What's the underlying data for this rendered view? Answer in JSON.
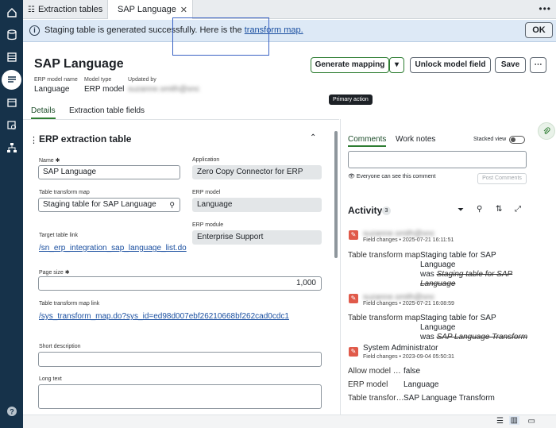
{
  "tabs": {
    "tab1": "Extraction tables",
    "tab2": "SAP Language"
  },
  "banner": {
    "message": "Staging table is generated successfully. Here is the ",
    "link": "transform map.",
    "ok": "OK"
  },
  "record": {
    "title": "SAP Language",
    "meta_model_name_label": "ERP model name",
    "meta_model_name": "Language",
    "meta_model_type_label": "Model type",
    "meta_model_type": "ERP model",
    "meta_updated_label": "Updated by",
    "meta_updated": "suzanne.smith@snc"
  },
  "buttons": {
    "generate": "Generate mapping",
    "unlock": "Unlock model field",
    "save": "Save",
    "tooltip": "Primary action"
  },
  "form_tabs": {
    "details": "Details",
    "fields": "Extraction table fields"
  },
  "section": {
    "title": "ERP extraction table"
  },
  "form": {
    "name_label": "Name",
    "name_value": "SAP Language",
    "application_label": "Application",
    "application_value": "Zero Copy Connector for ERP",
    "ttm_label": "Table transform map",
    "ttm_value": "Staging table for SAP Language",
    "erp_model_label": "ERP model",
    "erp_model_value": "Language",
    "erp_module_label": "ERP module",
    "erp_module_value": "Enterprise Support",
    "target_link_label": "Target table link",
    "target_link_value": "/sn_erp_integration_sap_language_list.do",
    "page_size_label": "Page size",
    "page_size_value": "1,000",
    "ttm_link_label": "Table transform map link",
    "ttm_link_value": "/sys_transform_map.do?sys_id=ed98d007ebf26210668bf262cad0cdc1",
    "short_desc_label": "Short description",
    "long_text_label": "Long text"
  },
  "right": {
    "comments_tab": "Comments",
    "worknotes_tab": "Work notes",
    "stacked": "Stacked view",
    "visibility": "Everyone can see this comment",
    "post": "Post Comments",
    "activity": "Activity",
    "activity_count": "3",
    "entries": [
      {
        "user": "suzanne.smith@snc",
        "sub": "Field changes • 2025-07-21 16:11:51",
        "key": "Table transform map",
        "new": "Staging table for SAP Language",
        "was": "was",
        "old": "Staging table for SAP Language"
      },
      {
        "user": "suzanne.smith@snc",
        "sub": "Field changes • 2025-07-21 16:08:59",
        "key": "Table transform map",
        "new": "Staging table for SAP Language",
        "was": "was",
        "old": "SAP Language Transform"
      },
      {
        "user": "System Administrator",
        "sub": "Field changes • 2023-09-04 05:50:31",
        "k1": "Allow model …",
        "v1": "false",
        "k2": "ERP model",
        "v2": "Language",
        "k3": "Table transfor…",
        "v3": "SAP Language Transform"
      }
    ]
  },
  "colors": {
    "rail": "#16324a",
    "banner": "#dde9f6",
    "accent": "#2e7d32",
    "link": "#1a4fa0",
    "activity_icon": "#e05a4a"
  }
}
